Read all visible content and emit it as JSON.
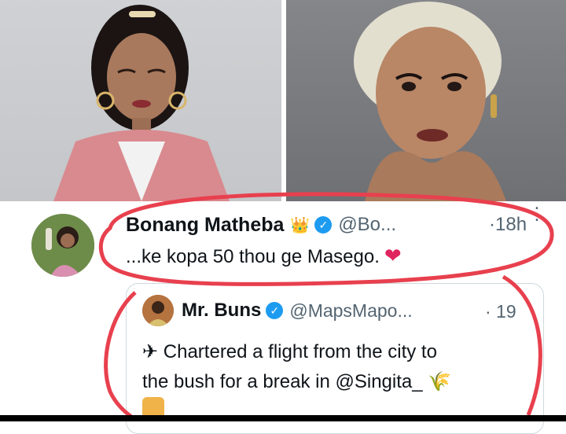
{
  "tweet": {
    "display_name": "Bonang Matheba",
    "crown_emoji": "👑",
    "verified_icon": "verified-badge-icon",
    "handle": "@Bo...",
    "time": "·18h",
    "text": "...ke kopa 50 thou ge Masego.",
    "heart": "❤"
  },
  "quote": {
    "display_name": "Mr. Buns",
    "handle": "@MapsMapo...",
    "time": "· 19",
    "line1": "✈ Chartered a flight from the city to",
    "line2": "the bush for a break in @Singita_ 🌾"
  },
  "colors": {
    "verified": "#1d9bf0",
    "ink": "#e8404e",
    "text": "#0f1419",
    "muted": "#536471"
  }
}
